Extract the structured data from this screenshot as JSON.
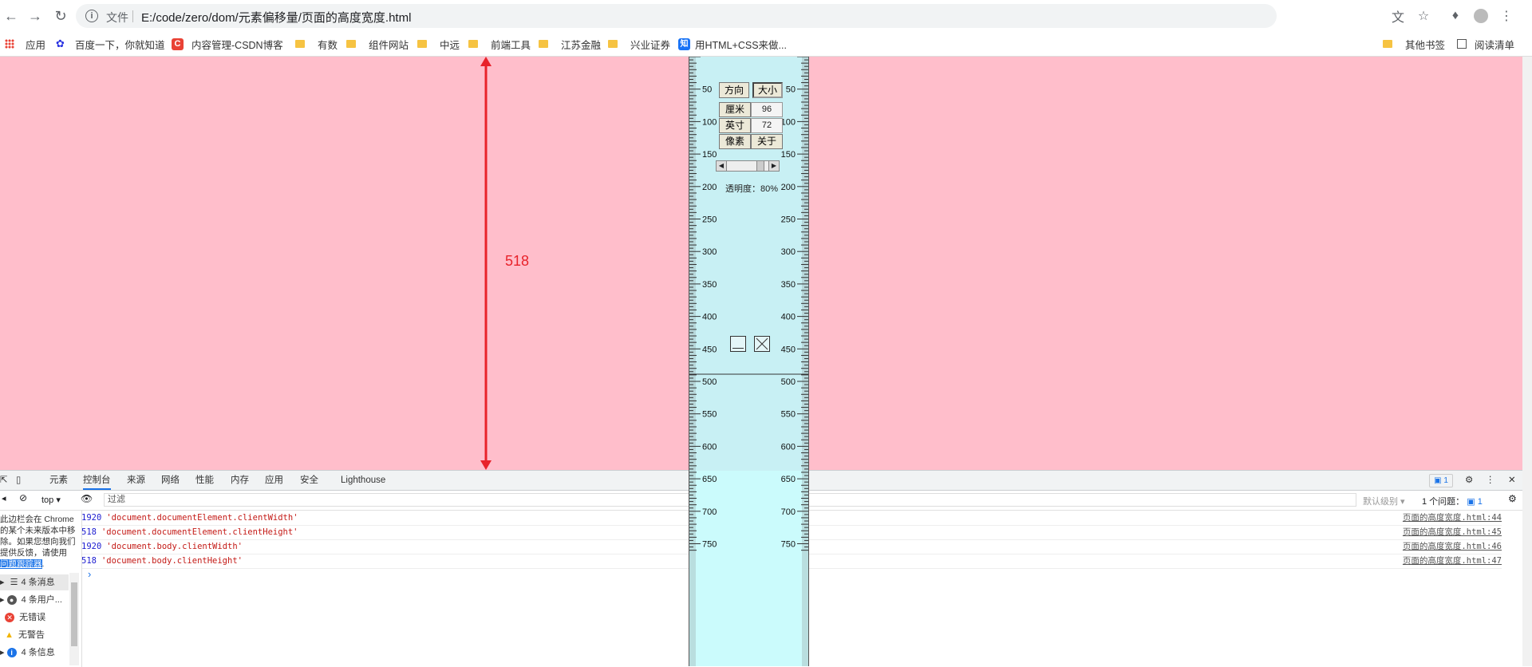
{
  "browser": {
    "info_label": "文件",
    "url": "E:/code/zero/dom/元素偏移量/页面的高度宽度.html",
    "icons": [
      "back-icon",
      "forward-icon",
      "reload-icon",
      "info-icon",
      "translate-icon",
      "star-icon",
      "extensions-icon",
      "profile-icon",
      "menu-icon"
    ]
  },
  "bookmarks": {
    "items": [
      {
        "label": "应用",
        "icon": "apps-icon"
      },
      {
        "label": "百度一下，你就知道",
        "icon": "baidu-icon"
      },
      {
        "label": "内容管理-CSDN博客",
        "icon": "csdn-icon"
      },
      {
        "label": "有数",
        "icon": "folder-icon"
      },
      {
        "label": "组件网站",
        "icon": "folder-icon"
      },
      {
        "label": "中远",
        "icon": "folder-icon"
      },
      {
        "label": "前端工具",
        "icon": "folder-icon"
      },
      {
        "label": "江苏金融",
        "icon": "folder-icon"
      },
      {
        "label": "兴业证券",
        "icon": "folder-icon"
      },
      {
        "label": "用HTML+CSS来做...",
        "icon": "zhihu-icon"
      }
    ],
    "other_label": "其他书签",
    "reading_label": "阅读清单"
  },
  "page": {
    "background": "#ffbecb",
    "arrow_label": "518",
    "arrow_color": "#e8222a"
  },
  "ruler": {
    "buttons": {
      "direction": "方向",
      "size": "大小",
      "cm": "厘米",
      "cm_value": "96",
      "inch": "英寸",
      "inch_value": "72",
      "pixel": "像素",
      "about": "关于"
    },
    "opacity_label": "透明度：80%",
    "opacity": 0.8,
    "ticks": [
      "50",
      "100",
      "150",
      "200",
      "250",
      "300",
      "350",
      "400",
      "450",
      "500",
      "550",
      "600",
      "650",
      "700",
      "750"
    ]
  },
  "devtools": {
    "tabs": [
      "元素",
      "控制台",
      "来源",
      "网络",
      "性能",
      "内存",
      "应用",
      "安全",
      "Lighthouse"
    ],
    "active_tab": "控制台",
    "badge": "1",
    "context": "top",
    "filter_placeholder": "过滤",
    "levels": "默认级别",
    "issues_label": "1 个问题：",
    "issues_count": "1",
    "logs": [
      {
        "num": "1920",
        "text": "'document.documentElement.clientWidth'",
        "src": "页面的高度宽度.html:44"
      },
      {
        "num": "518",
        "text": "'document.documentElement.clientHeight'",
        "src": "页面的高度宽度.html:45"
      },
      {
        "num": "1920",
        "text": "'document.body.clientWidth'",
        "src": "页面的高度宽度.html:46"
      },
      {
        "num": "518",
        "text": "'document.body.clientHeight'",
        "src": "页面的高度宽度.html:47"
      }
    ],
    "prompt": "›",
    "sidebar": {
      "notice_lines": [
        "此边栏会在 Chrome",
        "的某个未来版本中移",
        "除。如果您想向我们",
        "提供反馈，请使用"
      ],
      "notice_link": "问题跟踪器",
      "items": [
        {
          "label": "4 条消息",
          "icon": "list-icon"
        },
        {
          "label": "4 条用户...",
          "icon": "user-icon"
        },
        {
          "label": "无错误",
          "icon": "error-icon"
        },
        {
          "label": "无警告",
          "icon": "warning-icon"
        },
        {
          "label": "4 条信息",
          "icon": "info-icon"
        }
      ]
    }
  }
}
